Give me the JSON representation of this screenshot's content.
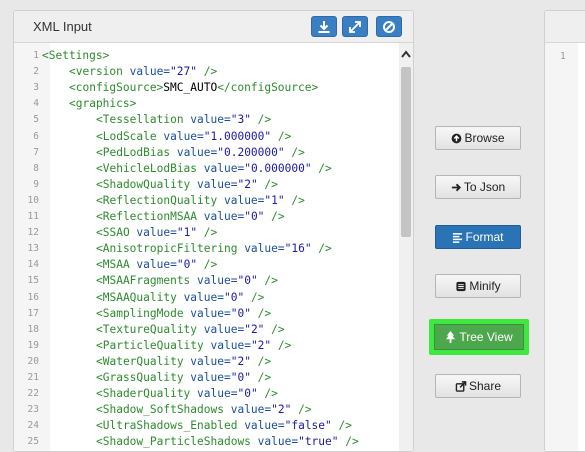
{
  "left_panel": {
    "title": "XML Input",
    "header_buttons": [
      "download-icon",
      "expand-icon",
      "clear-icon"
    ]
  },
  "editor": {
    "lines": [
      {
        "n": "1",
        "i": 0,
        "parts": [
          [
            "tag",
            "<Settings>"
          ]
        ]
      },
      {
        "n": "2",
        "i": 1,
        "parts": [
          [
            "tag",
            "<version "
          ],
          [
            "attr",
            "value="
          ],
          [
            "val",
            "\"27\""
          ],
          [
            "tag",
            " />"
          ]
        ]
      },
      {
        "n": "3",
        "i": 1,
        "parts": [
          [
            "tag",
            "<configSource>"
          ],
          [
            "txt",
            "SMC_AUTO"
          ],
          [
            "tag",
            "</configSource>"
          ]
        ]
      },
      {
        "n": "4",
        "i": 1,
        "parts": [
          [
            "tag",
            "<graphics>"
          ]
        ]
      },
      {
        "n": "5",
        "i": 2,
        "parts": [
          [
            "tag",
            "<Tessellation "
          ],
          [
            "attr",
            "value="
          ],
          [
            "val",
            "\"3\""
          ],
          [
            "tag",
            " />"
          ]
        ]
      },
      {
        "n": "6",
        "i": 2,
        "parts": [
          [
            "tag",
            "<LodScale "
          ],
          [
            "attr",
            "value="
          ],
          [
            "val",
            "\"1.000000\""
          ],
          [
            "tag",
            " />"
          ]
        ]
      },
      {
        "n": "7",
        "i": 2,
        "parts": [
          [
            "tag",
            "<PedLodBias "
          ],
          [
            "attr",
            "value="
          ],
          [
            "val",
            "\"0.200000\""
          ],
          [
            "tag",
            " />"
          ]
        ]
      },
      {
        "n": "8",
        "i": 2,
        "parts": [
          [
            "tag",
            "<VehicleLodBias "
          ],
          [
            "attr",
            "value="
          ],
          [
            "val",
            "\"0.000000\""
          ],
          [
            "tag",
            " />"
          ]
        ]
      },
      {
        "n": "9",
        "i": 2,
        "parts": [
          [
            "tag",
            "<ShadowQuality "
          ],
          [
            "attr",
            "value="
          ],
          [
            "val",
            "\"2\""
          ],
          [
            "tag",
            " />"
          ]
        ]
      },
      {
        "n": "10",
        "i": 2,
        "parts": [
          [
            "tag",
            "<ReflectionQuality "
          ],
          [
            "attr",
            "value="
          ],
          [
            "val",
            "\"1\""
          ],
          [
            "tag",
            " />"
          ]
        ]
      },
      {
        "n": "11",
        "i": 2,
        "parts": [
          [
            "tag",
            "<ReflectionMSAA "
          ],
          [
            "attr",
            "value="
          ],
          [
            "val",
            "\"0\""
          ],
          [
            "tag",
            " />"
          ]
        ]
      },
      {
        "n": "12",
        "i": 2,
        "parts": [
          [
            "tag",
            "<SSAO "
          ],
          [
            "attr",
            "value="
          ],
          [
            "val",
            "\"1\""
          ],
          [
            "tag",
            " />"
          ]
        ]
      },
      {
        "n": "13",
        "i": 2,
        "parts": [
          [
            "tag",
            "<AnisotropicFiltering "
          ],
          [
            "attr",
            "value="
          ],
          [
            "val",
            "\"16\""
          ],
          [
            "tag",
            " />"
          ]
        ]
      },
      {
        "n": "14",
        "i": 2,
        "parts": [
          [
            "tag",
            "<MSAA "
          ],
          [
            "attr",
            "value="
          ],
          [
            "val",
            "\"0\""
          ],
          [
            "tag",
            " />"
          ]
        ]
      },
      {
        "n": "15",
        "i": 2,
        "parts": [
          [
            "tag",
            "<MSAAFragments "
          ],
          [
            "attr",
            "value="
          ],
          [
            "val",
            "\"0\""
          ],
          [
            "tag",
            " />"
          ]
        ]
      },
      {
        "n": "16",
        "i": 2,
        "parts": [
          [
            "tag",
            "<MSAAQuality "
          ],
          [
            "attr",
            "value="
          ],
          [
            "val",
            "\"0\""
          ],
          [
            "tag",
            " />"
          ]
        ]
      },
      {
        "n": "17",
        "i": 2,
        "parts": [
          [
            "tag",
            "<SamplingMode "
          ],
          [
            "attr",
            "value="
          ],
          [
            "val",
            "\"0\""
          ],
          [
            "tag",
            " />"
          ]
        ]
      },
      {
        "n": "18",
        "i": 2,
        "parts": [
          [
            "tag",
            "<TextureQuality "
          ],
          [
            "attr",
            "value="
          ],
          [
            "val",
            "\"2\""
          ],
          [
            "tag",
            " />"
          ]
        ]
      },
      {
        "n": "19",
        "i": 2,
        "parts": [
          [
            "tag",
            "<ParticleQuality "
          ],
          [
            "attr",
            "value="
          ],
          [
            "val",
            "\"2\""
          ],
          [
            "tag",
            " />"
          ]
        ]
      },
      {
        "n": "20",
        "i": 2,
        "parts": [
          [
            "tag",
            "<WaterQuality "
          ],
          [
            "attr",
            "value="
          ],
          [
            "val",
            "\"2\""
          ],
          [
            "tag",
            " />"
          ]
        ]
      },
      {
        "n": "21",
        "i": 2,
        "parts": [
          [
            "tag",
            "<GrassQuality "
          ],
          [
            "attr",
            "value="
          ],
          [
            "val",
            "\"0\""
          ],
          [
            "tag",
            " />"
          ]
        ]
      },
      {
        "n": "22",
        "i": 2,
        "parts": [
          [
            "tag",
            "<ShaderQuality "
          ],
          [
            "attr",
            "value="
          ],
          [
            "val",
            "\"0\""
          ],
          [
            "tag",
            " />"
          ]
        ]
      },
      {
        "n": "23",
        "i": 2,
        "parts": [
          [
            "tag",
            "<Shadow_SoftShadows "
          ],
          [
            "attr",
            "value="
          ],
          [
            "val",
            "\"2\""
          ],
          [
            "tag",
            " />"
          ]
        ]
      },
      {
        "n": "24",
        "i": 2,
        "parts": [
          [
            "tag",
            "<UltraShadows_Enabled "
          ],
          [
            "attr",
            "value="
          ],
          [
            "val",
            "\"false\""
          ],
          [
            "tag",
            " />"
          ]
        ]
      },
      {
        "n": "25",
        "i": 2,
        "parts": [
          [
            "tag",
            "<Shadow_ParticleShadows "
          ],
          [
            "attr",
            "value="
          ],
          [
            "val",
            "\"true\""
          ],
          [
            "tag",
            " />"
          ]
        ]
      }
    ]
  },
  "actions": {
    "browse": "Browse",
    "to_json": "To Json",
    "format": "Format",
    "minify": "Minify",
    "tree_view": "Tree View",
    "share": "Share"
  },
  "right_panel": {
    "line_number": "1"
  },
  "colors": {
    "tag": "#2e8b2e",
    "attr": "#1a4f9c",
    "value": "#1a1aa6",
    "primary": "#2a74b5",
    "tree_button": "#4da84d",
    "highlight": "#3ee83e"
  }
}
